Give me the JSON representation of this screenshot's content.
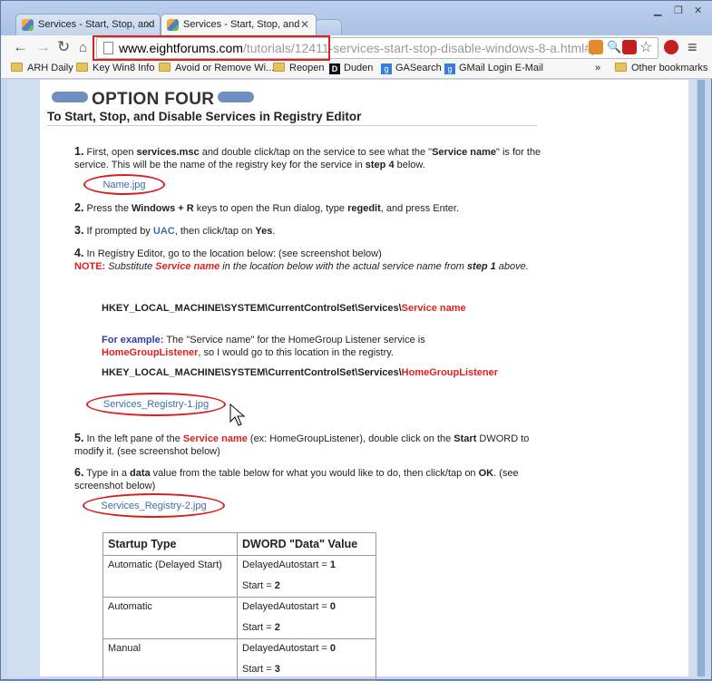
{
  "browser": {
    "tabs": [
      {
        "title": "Services - Start, Stop, and",
        "active": false
      },
      {
        "title": "Services - Start, Stop, and",
        "active": true
      }
    ],
    "url_domain": "www.eightforums.com",
    "url_path": "/tutorials/12411-services-start-stop-disable-windows-8-a.html#p",
    "bookmarks": [
      {
        "label": "ARH Daily",
        "icon": "folder-icon"
      },
      {
        "label": "Key Win8 Info",
        "icon": "folder-icon"
      },
      {
        "label": "Avoid or Remove Wi...",
        "icon": "folder-icon"
      },
      {
        "label": "Reopen",
        "icon": "folder-icon"
      },
      {
        "label": "Duden",
        "icon": "duden-icon"
      },
      {
        "label": "GASearch",
        "icon": "google-icon"
      },
      {
        "label": "GMail Login E-Mail",
        "icon": "google-icon"
      }
    ],
    "overflow": "»",
    "other_bookmarks": "Other bookmarks"
  },
  "article": {
    "title": "OPTION FOUR",
    "subtitle": "To Start, Stop, and Disable Services in Registry Editor",
    "step1": {
      "num": "1.",
      "a": " First, open ",
      "b": "services.msc",
      "c": " and double click/tap on the service to see what the \"",
      "d": "Service name",
      "e": "\" is for the service. This will be the name of the registry key for the service in ",
      "f": "step 4",
      "g": " below."
    },
    "attach1": "Name.jpg",
    "step2": {
      "num": "2.",
      "a": " Press the ",
      "b": "Windows",
      "c": " + ",
      "d": "R",
      "e": " keys to open the Run dialog, type ",
      "f": "regedit",
      "g": ", and press Enter."
    },
    "step3": {
      "num": "3.",
      "a": " If prompted by ",
      "b": "UAC",
      "c": ", then click/tap on ",
      "d": "Yes",
      "e": "."
    },
    "step4": {
      "num": "4.",
      "a": " In Registry Editor, go to the location below: (see screenshot below)",
      "note": "NOTE:",
      "n1": " Substitute ",
      "n2": "Service name",
      "n3": " in the location below with the actual service name from ",
      "n4": "step 1",
      "n5": " above."
    },
    "path1_prefix": "HKEY_LOCAL_MACHINE\\SYSTEM\\CurrentControlSet\\Services\\",
    "path1_suffix": "Service name",
    "example": {
      "label": "For example:",
      "a": " The \"Service name\" for the HomeGroup Listener service is ",
      "b": "HomeGroupListener",
      "c": ", so I would go to this location in the registry."
    },
    "path2_prefix": "HKEY_LOCAL_MACHINE\\SYSTEM\\CurrentControlSet\\Services\\",
    "path2_suffix": "HomeGroupListener",
    "attach2": "Services_Registry-1.jpg",
    "step5": {
      "num": "5.",
      "a": " In the left pane of the ",
      "b": "Service name",
      "c": " (ex: HomeGroupListener), double click on the ",
      "d": "Start",
      "e": " DWORD to modify it. (see screenshot below)"
    },
    "step6": {
      "num": "6.",
      "a": " Type in a ",
      "b": "data",
      "c": " value from the table below for what you would like to do, then click/tap on ",
      "d": "OK",
      "e": ". (see screenshot below)"
    },
    "attach3": "Services_Registry-2.jpg",
    "table": {
      "headers": [
        "Startup Type",
        "DWORD \"Data\" Value"
      ],
      "rows": [
        {
          "type": "Automatic (Delayed Start)",
          "l1": "DelayedAutostart = ",
          "v1": "1",
          "l2": "Start = ",
          "v2": "2"
        },
        {
          "type": "Automatic",
          "l1": "DelayedAutostart = ",
          "v1": "0",
          "l2": "Start = ",
          "v2": "2"
        },
        {
          "type": "Manual",
          "l1": "DelayedAutostart = ",
          "v1": "0",
          "l2": "Start = ",
          "v2": "3"
        }
      ]
    }
  }
}
